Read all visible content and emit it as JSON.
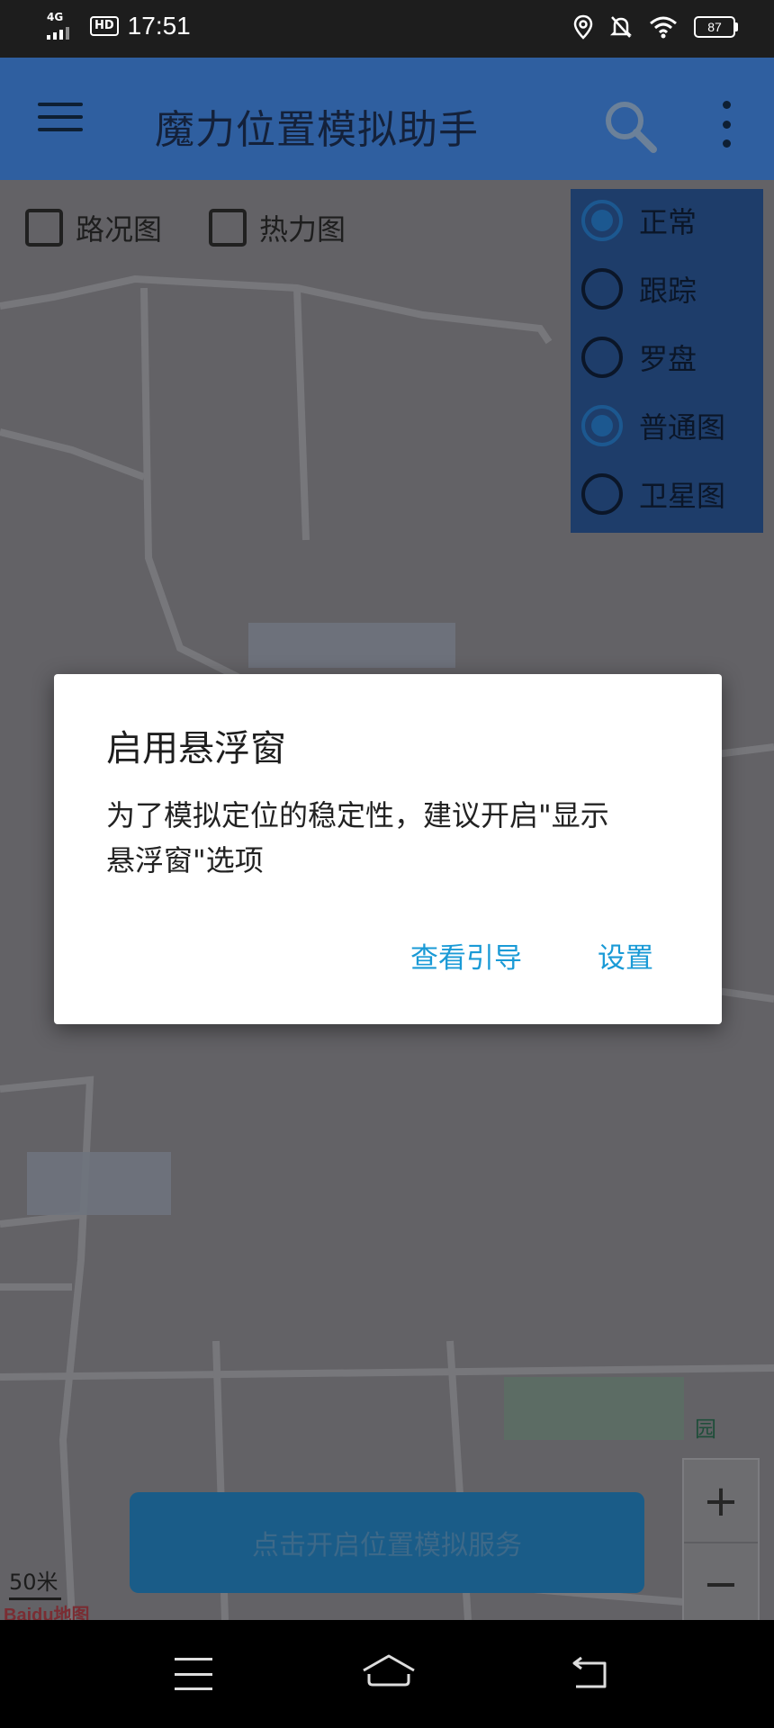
{
  "status_bar": {
    "network": "4G",
    "hd": "HD",
    "time": "17:51",
    "battery": "87"
  },
  "app_bar": {
    "title": "魔力位置模拟助手"
  },
  "map_controls": {
    "traffic_label": "路况图",
    "heat_label": "热力图",
    "modes": [
      {
        "label": "正常",
        "checked": true
      },
      {
        "label": "跟踪",
        "checked": false
      },
      {
        "label": "罗盘",
        "checked": false
      }
    ],
    "map_types": [
      {
        "label": "普通图",
        "checked": true
      },
      {
        "label": "卫星图",
        "checked": false
      }
    ],
    "zoom_in": "+",
    "zoom_out": "−",
    "scale": "50米",
    "logo": "Baidu地图",
    "park_label": "园"
  },
  "start_button": {
    "label": "点击开启位置模拟服务"
  },
  "dialog": {
    "title": "启用悬浮窗",
    "message": "为了模拟定位的稳定性，建议开启\"显示悬浮窗\"选项",
    "guide_button": "查看引导",
    "settings_button": "设置"
  },
  "colors": {
    "app_bar": "#2f5fa0",
    "dialog_button": "#1a9ad6",
    "start_button": "#1a5c88"
  }
}
